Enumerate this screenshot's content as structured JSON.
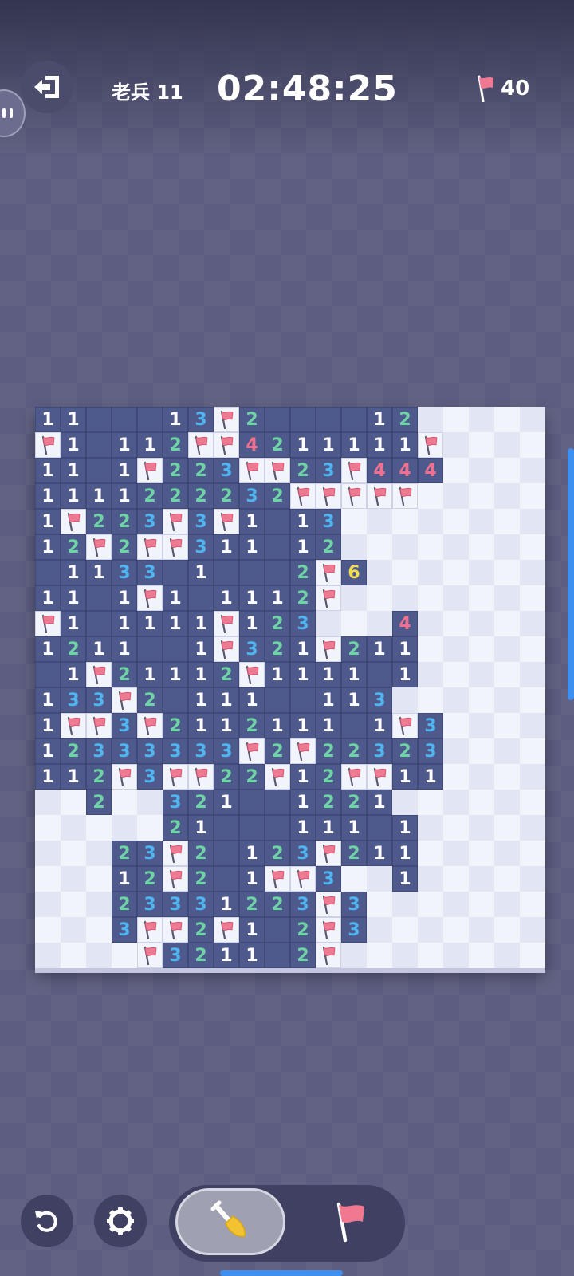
{
  "header": {
    "exit_icon": "exit-icon",
    "difficulty": "老兵 11",
    "timer": "02:48:25",
    "flags_remaining": "40"
  },
  "board": {
    "cols": 20,
    "rows": 22,
    "legend": "digits 1-8 = revealed number, '.' = revealed empty, 'F' = flag, '#' = hidden",
    "number_colors": {
      "1": "#ffffff",
      "2": "#6fd3a8",
      "3": "#4fb4f0",
      "4": "#f26e8e",
      "5": "#f26e8e",
      "6": "#f3dd52",
      "7": "#f3dd52",
      "8": "#f3dd52"
    },
    "grid": [
      "11...13F2....12#####",
      "F1.112FF4211111F####",
      "11.1F223FF23F444####",
      "1111222232FFFFF#####",
      "1F223F3F1.13########",
      "12F2FF311.12########",
      ".1133.1...2F6#######",
      "11.1F1.1112F########",
      "F1.1111F123###4#####",
      "1211..1F321F211#####",
      ".1F21112F1111.1#####",
      "133F2.111..113######",
      "1FF3F2112111.1F3####",
      "12333333F2F22323####",
      "112F3FF22F12FF11####",
      "##2##321..1221######",
      "#####21...111.1#####",
      "###23F2.123F211#####",
      "###12F2.1FF3##1#####",
      "###23331223F3#######",
      "###3FF2F1.2F3#######",
      "####F3211.2F########"
    ]
  },
  "controls": {
    "restart_icon": "restart-icon",
    "settings_icon": "gear-icon",
    "dig_mode_icon": "shovel-icon",
    "flag_mode_icon": "flag-icon",
    "selected_mode": "dig"
  },
  "colors": {
    "background": "#5c5d80",
    "revealed_cell": "#4f5a8c",
    "hidden_cell_light": "#f2f4fc",
    "hidden_cell_dark": "#e2e5f4",
    "flag": "#f07890",
    "scroll_indicator": "#3d8ff0"
  }
}
